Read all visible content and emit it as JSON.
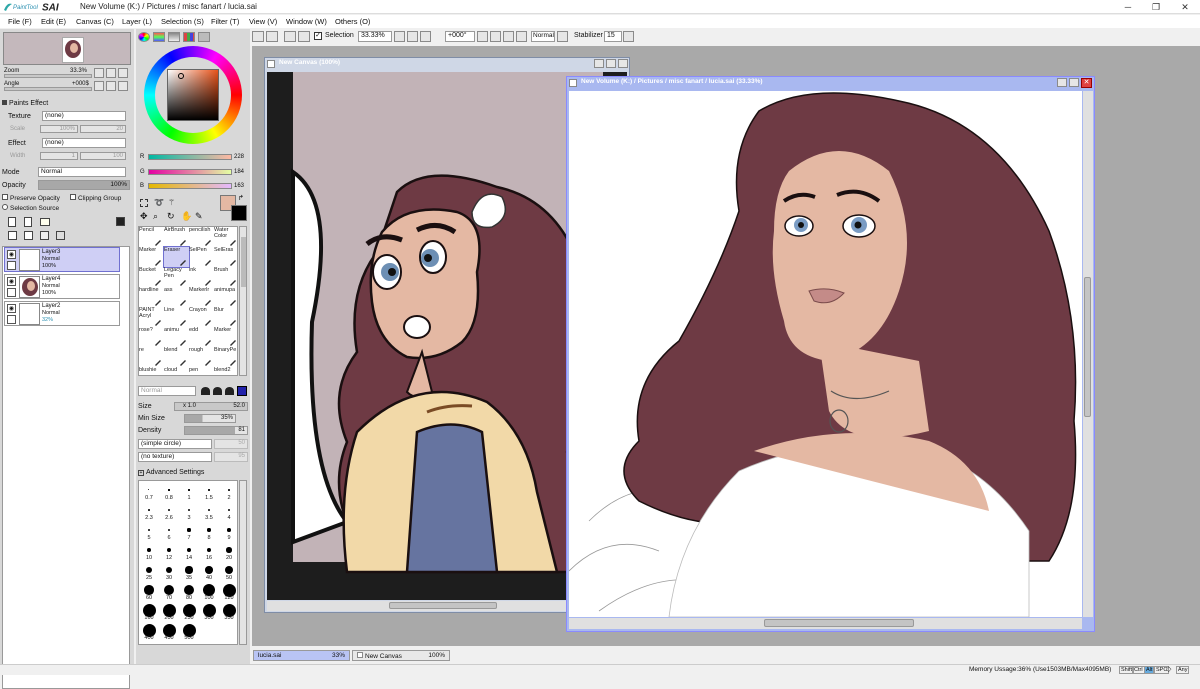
{
  "app": {
    "logo_text": "PaintTool SAI",
    "title": "New Volume (K:) / Pictures / misc fanart / lucia.sai",
    "controls": {
      "minimize": "─",
      "restore": "❐",
      "close": "✕"
    }
  },
  "menu": [
    "File (F)",
    "Edit (E)",
    "Canvas (C)",
    "Layer (L)",
    "Selection (S)",
    "Filter (T)",
    "View (V)",
    "Window (W)",
    "Others (O)"
  ],
  "navigator": {
    "zoom_label": "Zoom",
    "zoom_value": "33.3%",
    "angle_label": "Angle",
    "angle_value": "+000$"
  },
  "paints_effect": {
    "header": "Paints Effect",
    "texture_label": "Texture",
    "texture_value": "(none)",
    "scale_label": "Scale",
    "scale_value": "100%",
    "scale_num": "20",
    "effect_label": "Effect",
    "effect_value": "(none)",
    "width_label": "Width",
    "width_value": "1",
    "width_num": "100"
  },
  "layer_props": {
    "mode_label": "Mode",
    "mode_value": "Normal",
    "opacity_label": "Opacity",
    "opacity_value": "100%",
    "preserve_opacity": "Preserve Opacity",
    "clipping_group": "Clipping Group",
    "selection_source": "Selection Source"
  },
  "layers": [
    {
      "name": "Layer3",
      "mode": "Normal",
      "opacity": "100%",
      "selected": true
    },
    {
      "name": "Layer4",
      "mode": "Normal",
      "opacity": "100%",
      "selected": false
    },
    {
      "name": "Layer2",
      "mode": "Normal",
      "opacity": "32%",
      "selected": false
    }
  ],
  "color": {
    "r_label": "R",
    "r_value": "228",
    "g_label": "G",
    "g_value": "184",
    "b_label": "B",
    "b_value": "163",
    "primary": "#e4b8a3",
    "secondary": "#000000"
  },
  "tools": [
    {
      "label": "Pencil"
    },
    {
      "label": "AirBrush"
    },
    {
      "label": "pencilish"
    },
    {
      "label": "Water Color"
    },
    {
      "label": "Marker"
    },
    {
      "label": "Eraser",
      "selected": true
    },
    {
      "label": "SelPen"
    },
    {
      "label": "SelEras"
    },
    {
      "label": "Bucket"
    },
    {
      "label": "Legacy Pen"
    },
    {
      "label": "ink"
    },
    {
      "label": "Brush"
    },
    {
      "label": "hardline"
    },
    {
      "label": "ass"
    },
    {
      "label": "Markerlr"
    },
    {
      "label": "animupa"
    },
    {
      "label": "PAINT Acryl"
    },
    {
      "label": "Line"
    },
    {
      "label": "Crayon"
    },
    {
      "label": "Blur"
    },
    {
      "label": "rose?"
    },
    {
      "label": "animu"
    },
    {
      "label": "edd"
    },
    {
      "label": "Marker"
    },
    {
      "label": "re"
    },
    {
      "label": "blend"
    },
    {
      "label": "rough"
    },
    {
      "label": "BinaryPe"
    },
    {
      "label": "blushie"
    },
    {
      "label": "cloud"
    },
    {
      "label": "pen"
    },
    {
      "label": "blend2"
    }
  ],
  "brush": {
    "blend_mode": "Normal",
    "size_label": "Size",
    "size_mult": "x 1.0",
    "size_value": "52.0",
    "min_size_label": "Min Size",
    "min_size_value": "35%",
    "density_label": "Density",
    "density_value": "81",
    "shape_value": "(simple circle)",
    "shape_num": "50",
    "texture_value": "(no texture)",
    "texture_num": "95",
    "advanced_label": "Advanced Settings"
  },
  "brush_sizes": [
    "0.7",
    "0.8",
    "1",
    "1.5",
    "2",
    "2.3",
    "2.6",
    "3",
    "3.5",
    "4",
    "5",
    "6",
    "7",
    "8",
    "9",
    "10",
    "12",
    "14",
    "16",
    "20",
    "25",
    "30",
    "35",
    "40",
    "50",
    "60",
    "70",
    "80",
    "100",
    "120",
    "160",
    "200",
    "250",
    "300",
    "350",
    "400",
    "450",
    "500"
  ],
  "toolbar": {
    "selection_label": "Selection",
    "zoom_value": "33.33%",
    "angle_value": "+000°",
    "mode_value": "Normal",
    "stabilizer_label": "Stabilizer",
    "stabilizer_value": "15"
  },
  "canvas_windows": [
    {
      "title": "New Canvas (100%)"
    },
    {
      "title": "New Volume (K:) / Pictures / misc fanart / lucia.sai (33.33%)"
    }
  ],
  "taskbar": [
    {
      "name": "lucia.sai",
      "zoom": "33%"
    },
    {
      "name": "New Canvas",
      "zoom": "100%"
    }
  ],
  "status": {
    "memory": "Memory Ussage:36% (Use1503MB/Max4095MB)",
    "keys": [
      "Shift",
      "Ctrl",
      "Alt",
      "SPC",
      "◇",
      "Any"
    ]
  },
  "colors": {
    "hair": "#6e3a44",
    "skin": "#e4b8a3",
    "bg_pink": "#c2b3b7",
    "dress_yellow": "#f2d9a8",
    "corset_blue": "#6674a0"
  }
}
